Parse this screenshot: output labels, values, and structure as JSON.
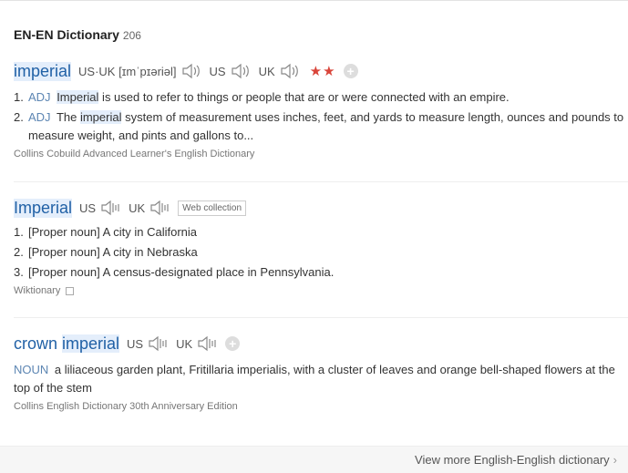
{
  "section": {
    "title": "EN-EN Dictionary",
    "count": "206"
  },
  "entry1": {
    "word": "imperial",
    "pron_label": "US·UK",
    "ipa": "[ɪmˈpɪəriəl]",
    "us": "US",
    "uk": "UK",
    "stars": "★★",
    "plus": "+",
    "defs": [
      {
        "num": "1.",
        "pos": "ADJ",
        "pre": "",
        "hl": "Imperial",
        "post": " is used to refer to things or people that are or were connected with an empire."
      },
      {
        "num": "2.",
        "pos": "ADJ",
        "pre": "The ",
        "hl": "imperial",
        "post": " system of measurement uses inches, feet, and yards to measure length, ounces and pounds to measure weight, and pints and gallons to..."
      }
    ],
    "source": "Collins Cobuild Advanced Learner's English Dictionary"
  },
  "entry2": {
    "word": "Imperial",
    "us": "US",
    "uk": "UK",
    "tag": "Web collection",
    "defs": [
      {
        "num": "1.",
        "text": "[Proper noun] A city in California"
      },
      {
        "num": "2.",
        "text": "[Proper noun] A city in Nebraska"
      },
      {
        "num": "3.",
        "text": "[Proper noun] A census-designated place in Pennsylvania."
      }
    ],
    "source": "Wiktionary"
  },
  "entry3": {
    "word_pre": "crown ",
    "word_hl": "imperial",
    "us": "US",
    "uk": "UK",
    "plus": "+",
    "pos": "NOUN",
    "def": "a liliaceous garden plant, Fritillaria imperialis, with a cluster of leaves and orange bell-shaped flowers at the top of the stem",
    "source": "Collins English Dictionary 30th Anniversary Edition"
  },
  "footer": {
    "more": "View more English-English dictionary",
    "chevron": "›"
  },
  "colors": {
    "link": "#2161a6",
    "highlight": "#e4eefb",
    "star": "#d9453a",
    "pos": "#5d86b3"
  }
}
